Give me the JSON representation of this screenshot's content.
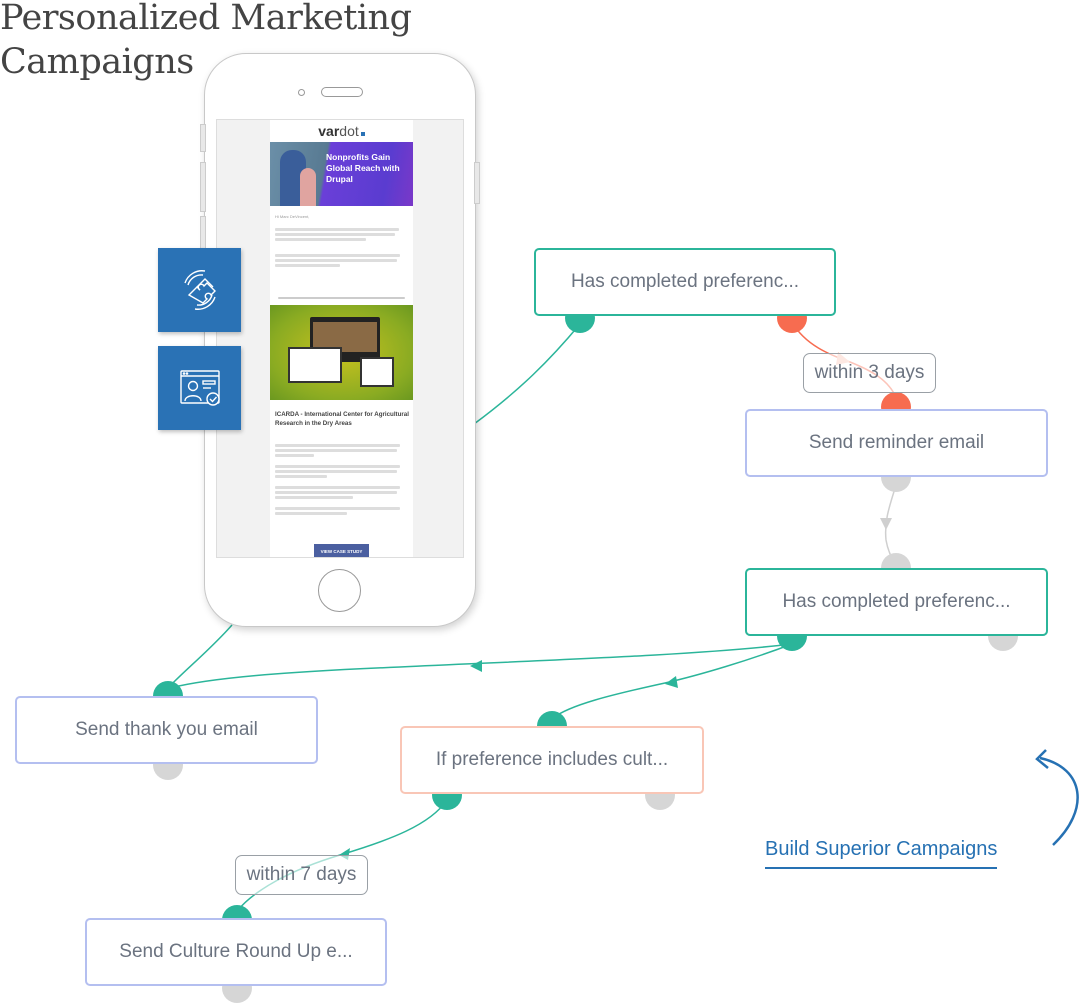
{
  "page": {
    "title_line1": "Personalized Marketing",
    "title_line2": "Campaigns"
  },
  "phone_email": {
    "brand_logo_bold": "var",
    "brand_logo_light": "dot",
    "hero_headline": "Nonprofits Gain Global Reach with Drupal",
    "greeting": "Hi Marc DeVincent,",
    "intro_paragraph": "Drupal has been increasingly adopted by nonprofit organizations around the world in recent years. Our team has had the pleasure of partnering up with major nonprofits such as Doctors Without Borders and UNOPS.",
    "second_paragraph": "Recently, we launched 2 new Drupal 8 websites that are very dear to our hearts and we wanted to share them with you to showcase Drupal's impact in creating engaging digital experiences.",
    "case_title": "ICARDA - International Center for Agricultural Research in the Dry Areas",
    "cta_label": "VIEW CASE STUDY"
  },
  "feature_tiles": [
    {
      "icon": "puzzle-integration-icon"
    },
    {
      "icon": "user-profile-verified-icon"
    }
  ],
  "workflow": {
    "nodes": [
      {
        "id": "cond1",
        "type": "condition",
        "label": "Has completed preferenc..."
      },
      {
        "id": "reminder",
        "type": "action",
        "label": "Send reminder email"
      },
      {
        "id": "cond2",
        "type": "condition",
        "label": "Has completed preferenc..."
      },
      {
        "id": "thanks",
        "type": "action",
        "label": "Send thank you email"
      },
      {
        "id": "branch",
        "type": "branch",
        "label": "If preference includes cult..."
      },
      {
        "id": "culture",
        "type": "action",
        "label": "Send Culture Round Up e..."
      }
    ],
    "delays": [
      {
        "label": "within 3 days"
      },
      {
        "label": "within 7 days"
      }
    ],
    "colors": {
      "yes_path": "#2bb59a",
      "no_path": "#f76c50",
      "inactive": "#d6d6d6",
      "action_border": "#b4bff0",
      "branch_border": "#f9c6b6"
    }
  },
  "cta_link": {
    "label": "Build Superior Campaigns",
    "color": "#2671b3"
  }
}
